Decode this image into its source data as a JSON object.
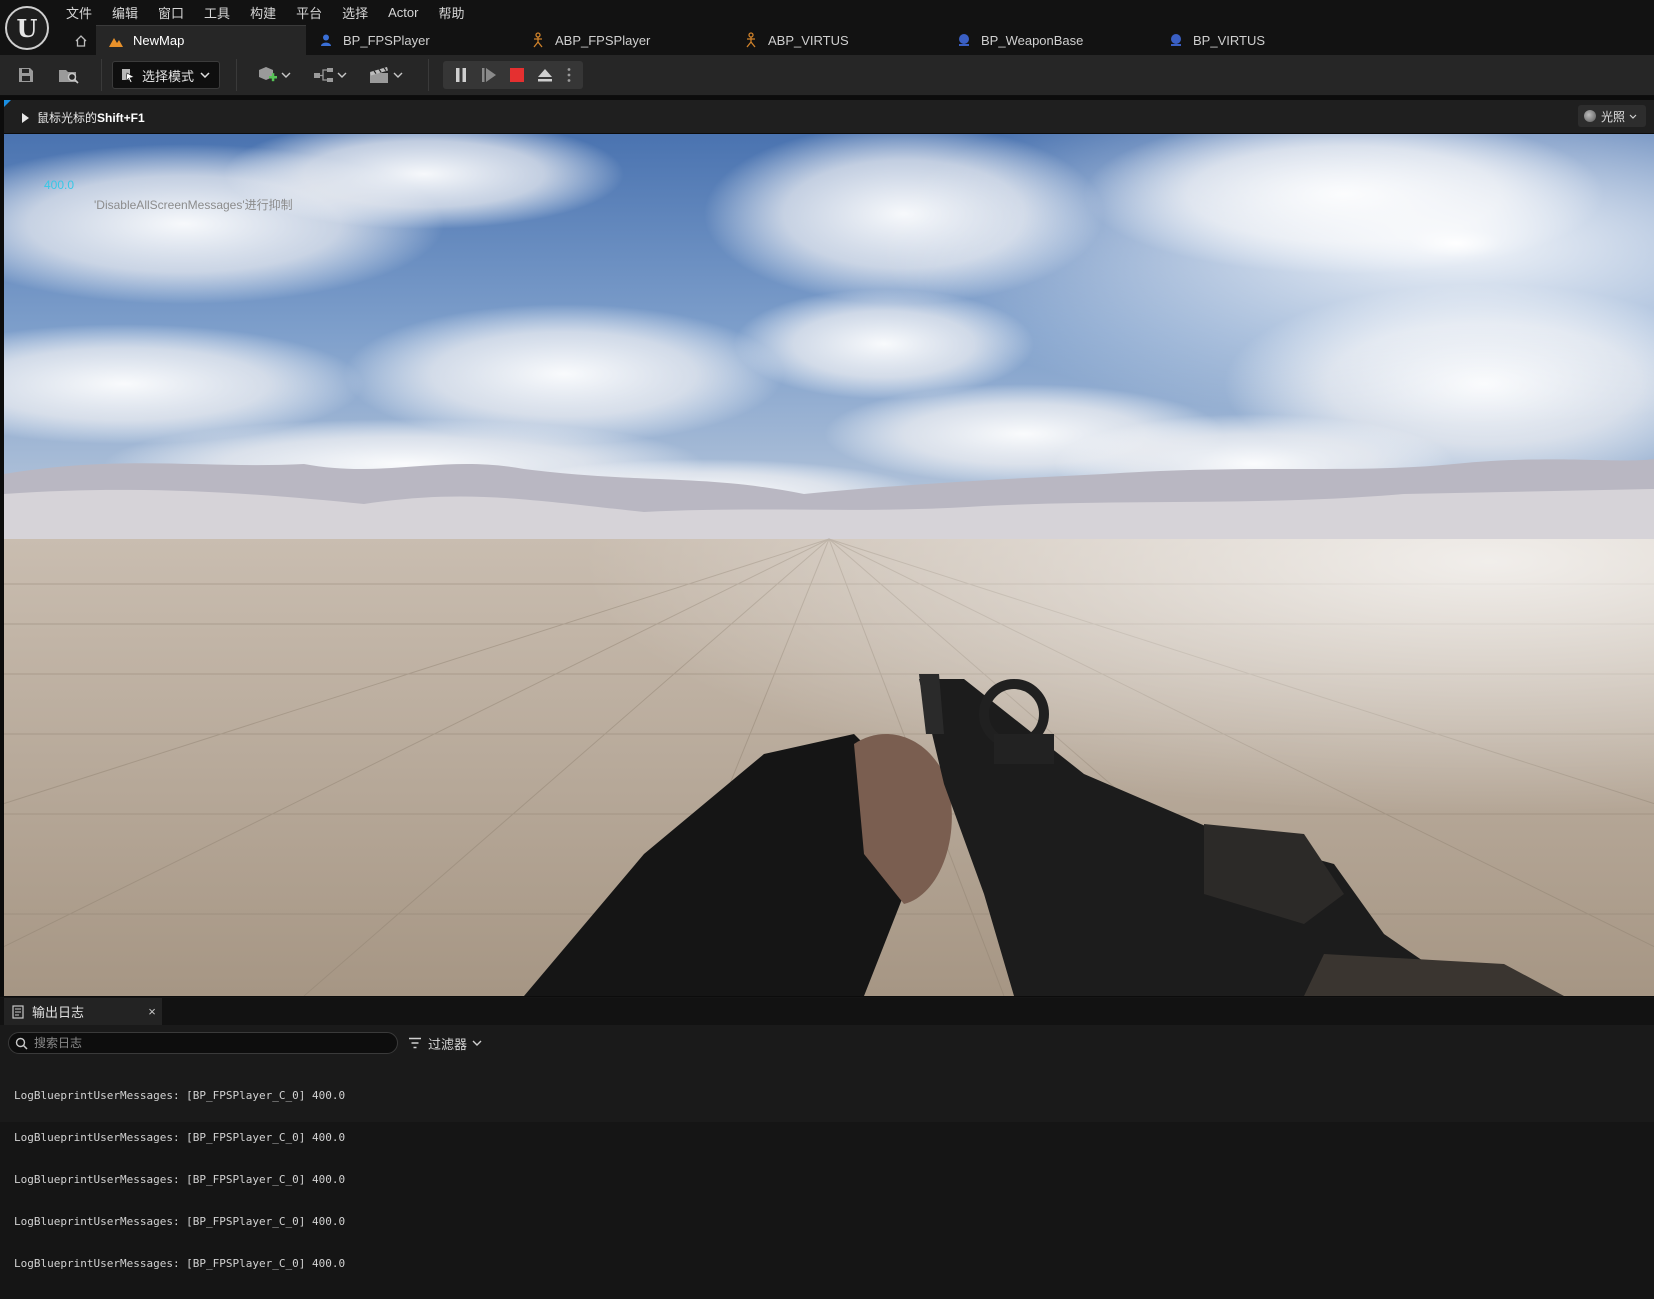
{
  "app": {
    "logo_text": "U"
  },
  "menu": [
    "文件",
    "编辑",
    "窗口",
    "工具",
    "构建",
    "平台",
    "选择",
    "Actor",
    "帮助"
  ],
  "tabs": [
    {
      "label": "NewMap",
      "icon": "level-icon",
      "active": true
    },
    {
      "label": "BP_FPSPlayer",
      "icon": "pawn-blueprint-icon",
      "active": false
    },
    {
      "label": "ABP_FPSPlayer",
      "icon": "animation-blueprint-icon",
      "active": false
    },
    {
      "label": "ABP_VIRTUS",
      "icon": "animation-blueprint-icon",
      "active": false
    },
    {
      "label": "BP_WeaponBase",
      "icon": "actor-blueprint-icon",
      "active": false
    },
    {
      "label": "BP_VIRTUS",
      "icon": "actor-blueprint-icon",
      "active": false
    }
  ],
  "toolbar": {
    "mode_label": "选择模式",
    "icons": [
      "save-icon",
      "content-browser-icon",
      "add-actor-icon",
      "blueprint-icon",
      "cinematics-icon",
      "pause-icon",
      "step-icon",
      "stop-icon",
      "eject-icon",
      "more-options-icon"
    ]
  },
  "viewport": {
    "hint_prefix": "鼠标光标的",
    "hint_key": "Shift+F1",
    "lighting_label": "光照",
    "debug_value": "400.0",
    "debug_message": "'DisableAllScreenMessages'进行抑制"
  },
  "output_log": {
    "tab_label": "输出日志",
    "close_glyph": "×",
    "search_placeholder": "搜索日志",
    "filter_label": "过滤器",
    "lines": [
      "LogBlueprintUserMessages: [BP_FPSPlayer_C_0] 400.0",
      "LogBlueprintUserMessages: [BP_FPSPlayer_C_0] 400.0",
      "LogBlueprintUserMessages: [BP_FPSPlayer_C_0] 400.0",
      "LogBlueprintUserMessages: [BP_FPSPlayer_C_0] 400.0",
      "LogBlueprintUserMessages: [BP_FPSPlayer_C_0] 400.0"
    ]
  },
  "colors": {
    "accent_blue": "#1a8fe3",
    "stop_red": "#e53030",
    "debug_cyan": "#36c8e6",
    "panel_bg": "#262626"
  }
}
